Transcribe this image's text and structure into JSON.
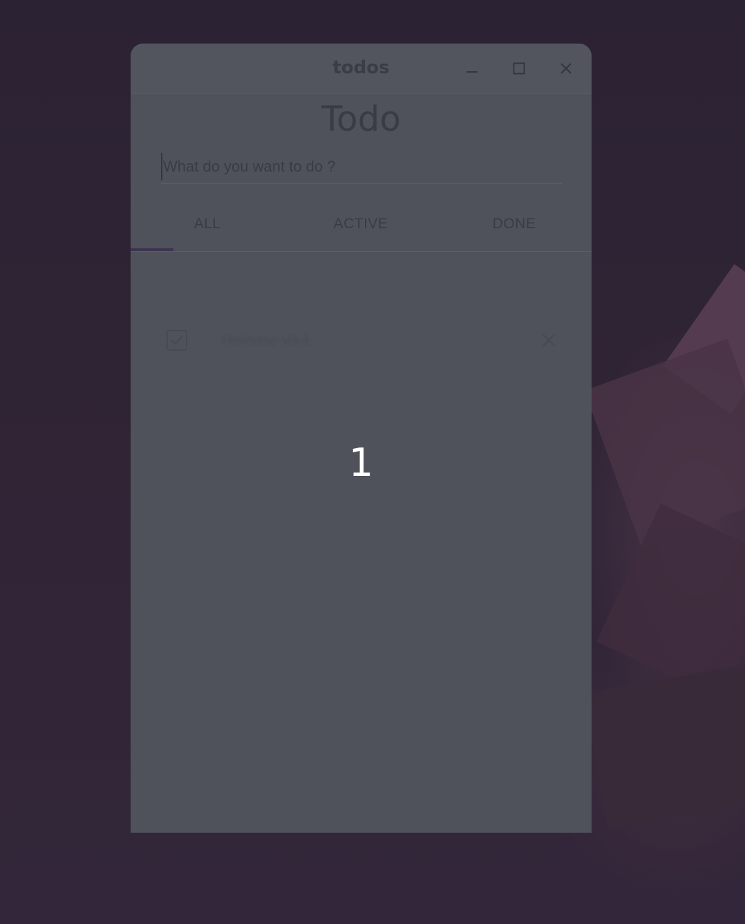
{
  "window": {
    "title": "todos",
    "controls": {
      "minimize_icon": "minimize-icon",
      "maximize_icon": "maximize-icon",
      "close_icon": "close-icon"
    }
  },
  "app": {
    "heading": "Todo",
    "input": {
      "placeholder": "What do you want to do ?",
      "value": ""
    },
    "tabs": [
      {
        "label": "ALL",
        "selected": true
      },
      {
        "label": "ACTIVE",
        "selected": false
      },
      {
        "label": "DONE",
        "selected": false
      }
    ],
    "todos": [
      {
        "text": "Release v3.1",
        "done": true
      }
    ]
  },
  "overlay": {
    "step_number": "1"
  },
  "colors": {
    "desktop_bg": "#2f2434",
    "window_bg": "#4f525b",
    "tab_indicator": "#3d3452",
    "text": "#3a3c43",
    "overlay_text": "#ffffff"
  }
}
